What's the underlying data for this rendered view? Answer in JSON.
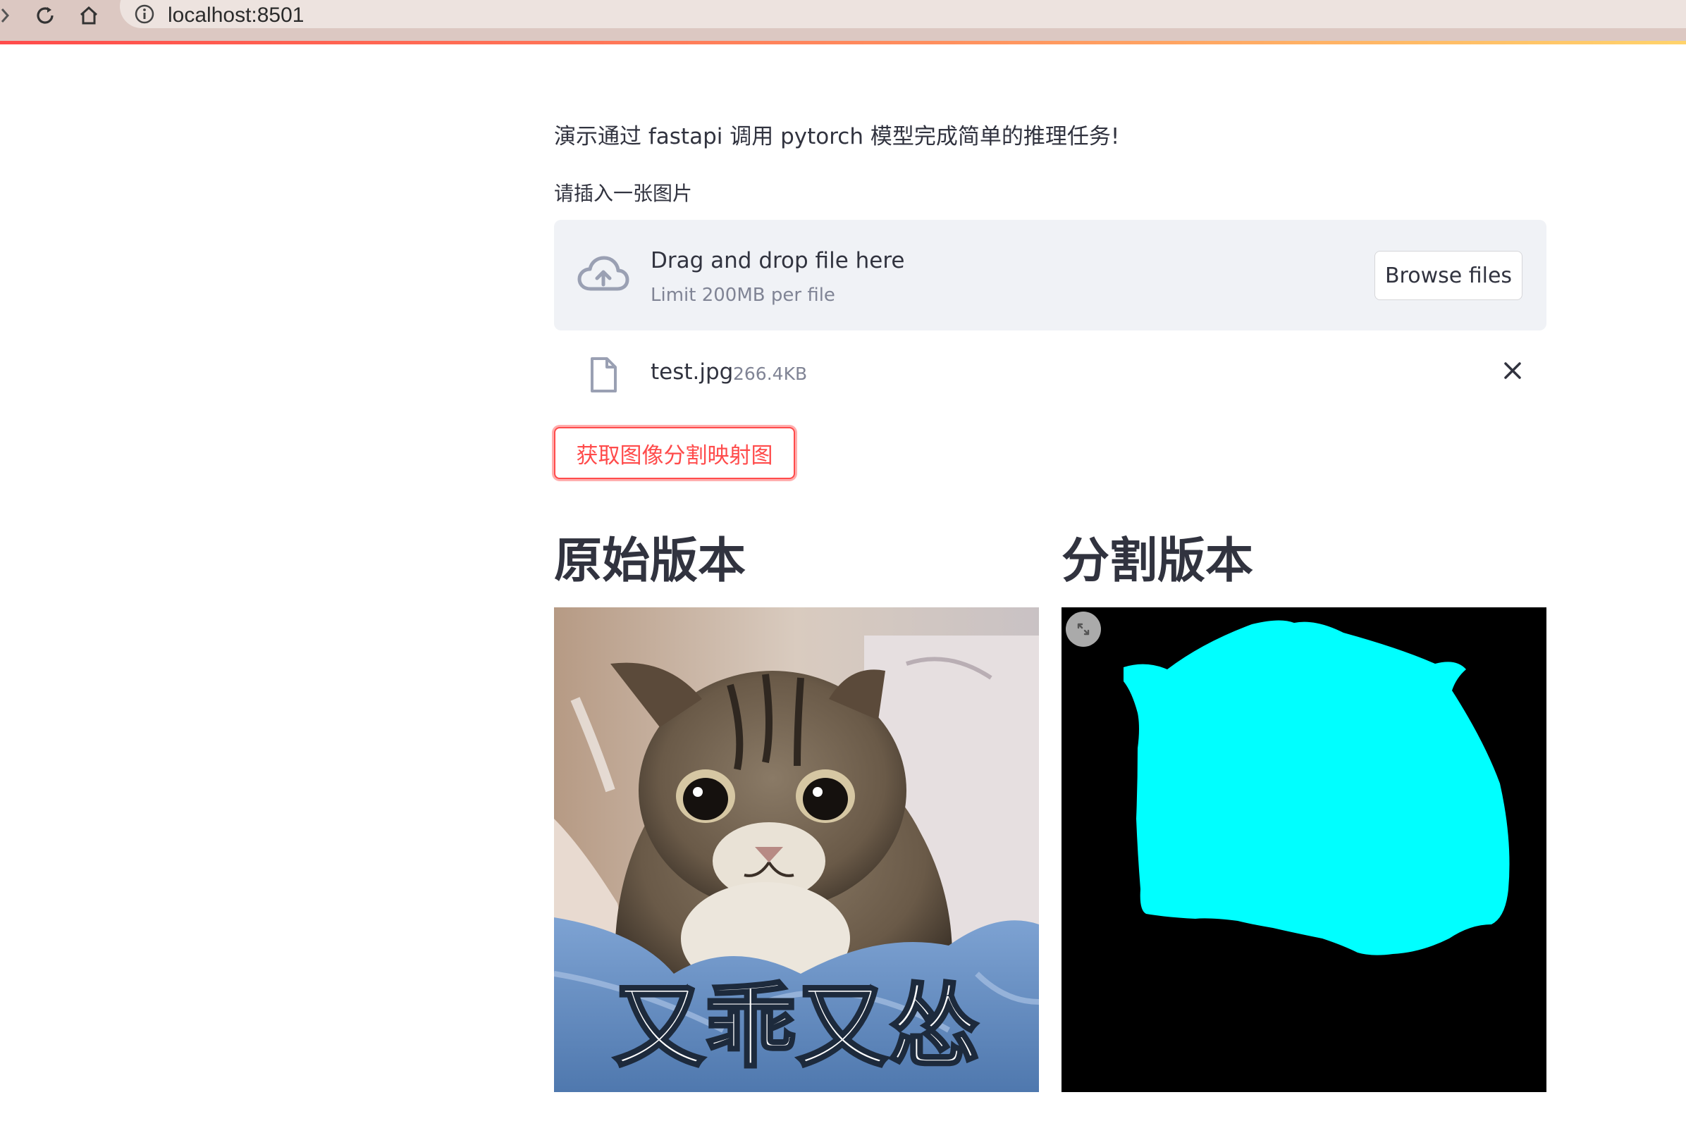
{
  "browser": {
    "url": "localhost:8501",
    "icons": [
      "back-icon",
      "reload-icon",
      "home-icon",
      "info-icon"
    ]
  },
  "app": {
    "intro_text": "演示通过 fastapi 调用 pytorch 模型完成简单的推理任务!",
    "uploader_label": "请插入一张图片",
    "dropzone": {
      "title": "Drag and drop file here",
      "subtitle": "Limit 200MB per file",
      "browse_label": "Browse files"
    },
    "uploaded_file": {
      "name": "test.jpg",
      "size": "266.4KB"
    },
    "action_button": "获取图像分割映射图",
    "columns": {
      "original_title": "原始版本",
      "segmented_title": "分割版本"
    },
    "original_image": {
      "caption_text": "又乖又怂"
    }
  },
  "colors": {
    "accent": "#ff4b4b",
    "dropzone_bg": "#f0f2f6",
    "text": "#31333f",
    "muted": "#808495",
    "mask": "#00ffff",
    "mask_bg": "#000000"
  }
}
